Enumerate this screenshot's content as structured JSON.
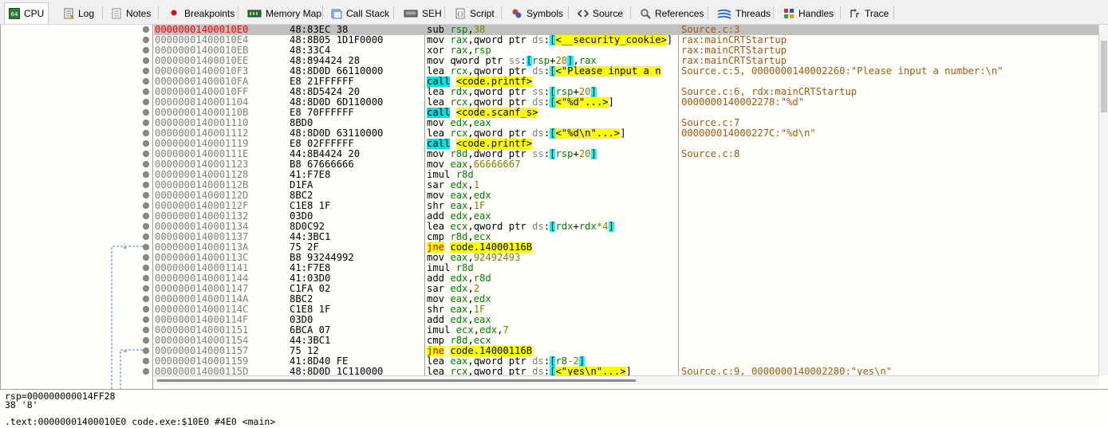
{
  "tabs": [
    {
      "label": "CPU",
      "icon": "cpu-icon",
      "active": true
    },
    {
      "label": "Log",
      "icon": "log-icon"
    },
    {
      "label": "Notes",
      "icon": "notes-icon"
    },
    {
      "label": "Breakpoints",
      "icon": "breakpoint-dot-icon"
    },
    {
      "label": "Memory Map",
      "icon": "memory-map-icon"
    },
    {
      "label": "Call Stack",
      "icon": "call-stack-icon"
    },
    {
      "label": "SEH",
      "icon": "seh-icon"
    },
    {
      "label": "Script",
      "icon": "script-icon"
    },
    {
      "label": "Symbols",
      "icon": "symbols-icon"
    },
    {
      "label": "Source",
      "icon": "source-icon"
    },
    {
      "label": "References",
      "icon": "references-icon"
    },
    {
      "label": "Threads",
      "icon": "threads-icon"
    },
    {
      "label": "Handles",
      "icon": "handles-icon"
    },
    {
      "label": "Trace",
      "icon": "trace-icon"
    }
  ],
  "cpu_icon_text": "64",
  "colors": {
    "selected_address": "#ff0000",
    "comment": "#a05a14",
    "register": "#008000",
    "highlight": "#ffff00",
    "call_highlight": "#00e0e0"
  },
  "disassembly": [
    {
      "address": "00000001400010E0",
      "bytes": "48:83EC 38",
      "instr": "sub rsp,38",
      "comment": "Source.c:3"
    },
    {
      "address": "00000001400010E4",
      "bytes": "48:8B05 1D1F0000",
      "instr": "mov rax,qword ptr ds:[<__security_cookie>]",
      "comment": "rax:mainCRTStartup"
    },
    {
      "address": "00000001400010EB",
      "bytes": "48:33C4",
      "instr": "xor rax,rsp",
      "comment": "rax:mainCRTStartup"
    },
    {
      "address": "00000001400010EE",
      "bytes": "48:894424 28",
      "instr": "mov qword ptr ss:[rsp+28],rax",
      "comment": "rax:mainCRTStartup"
    },
    {
      "address": "00000001400010F3",
      "bytes": "48:8D0D 66110000",
      "instr": "lea rcx,qword ptr ds:[<\"Please input a n",
      "comment": "Source.c:5, 0000000140002260:\"Please input a number:\\n\""
    },
    {
      "address": "00000001400010FA",
      "bytes": "E8 21FFFFFF",
      "instr": "call <code.printf>",
      "comment": ""
    },
    {
      "address": "00000001400010FF",
      "bytes": "48:8D5424 20",
      "instr": "lea rdx,qword ptr ss:[rsp+20]",
      "comment": "Source.c:6, rdx:mainCRTStartup"
    },
    {
      "address": "0000000140001104",
      "bytes": "48:8D0D 6D110000",
      "instr": "lea rcx,qword ptr ds:[<\"%d\"...>]",
      "comment": "0000000140002278:\"%d\""
    },
    {
      "address": "000000014000110B",
      "bytes": "E8 70FFFFFF",
      "instr": "call <code.scanf_s>",
      "comment": ""
    },
    {
      "address": "0000000140001110",
      "bytes": "8BD0",
      "instr": "mov edx,eax",
      "comment": "Source.c:7"
    },
    {
      "address": "0000000140001112",
      "bytes": "48:8D0D 63110000",
      "instr": "lea rcx,qword ptr ds:[<\"%d\\n\"...>]",
      "comment": "000000014000227C:\"%d\\n\""
    },
    {
      "address": "0000000140001119",
      "bytes": "E8 02FFFFFF",
      "instr": "call <code.printf>",
      "comment": ""
    },
    {
      "address": "000000014000111E",
      "bytes": "44:8B4424 20",
      "instr": "mov r8d,dword ptr ss:[rsp+20]",
      "comment": "Source.c:8"
    },
    {
      "address": "0000000140001123",
      "bytes": "B8 67666666",
      "instr": "mov eax,66666667",
      "comment": ""
    },
    {
      "address": "0000000140001128",
      "bytes": "41:F7E8",
      "instr": "imul r8d",
      "comment": ""
    },
    {
      "address": "000000014000112B",
      "bytes": "D1FA",
      "instr": "sar edx,1",
      "comment": ""
    },
    {
      "address": "000000014000112D",
      "bytes": "8BC2",
      "instr": "mov eax,edx",
      "comment": ""
    },
    {
      "address": "000000014000112F",
      "bytes": "C1E8 1F",
      "instr": "shr eax,1F",
      "comment": ""
    },
    {
      "address": "0000000140001132",
      "bytes": "03D0",
      "instr": "add edx,eax",
      "comment": ""
    },
    {
      "address": "0000000140001134",
      "bytes": "8D0C92",
      "instr": "lea ecx,qword ptr ds:[rdx+rdx*4]",
      "comment": ""
    },
    {
      "address": "0000000140001137",
      "bytes": "44:3BC1",
      "instr": "cmp r8d,ecx",
      "comment": ""
    },
    {
      "address": "000000014000113A",
      "bytes": "75 2F",
      "instr": "jne code.14000116B",
      "comment": ""
    },
    {
      "address": "000000014000113C",
      "bytes": "B8 93244992",
      "instr": "mov eax,92492493",
      "comment": ""
    },
    {
      "address": "0000000140001141",
      "bytes": "41:F7E8",
      "instr": "imul r8d",
      "comment": ""
    },
    {
      "address": "0000000140001144",
      "bytes": "41:03D0",
      "instr": "add edx,r8d",
      "comment": ""
    },
    {
      "address": "0000000140001147",
      "bytes": "C1FA 02",
      "instr": "sar edx,2",
      "comment": ""
    },
    {
      "address": "000000014000114A",
      "bytes": "8BC2",
      "instr": "mov eax,edx",
      "comment": ""
    },
    {
      "address": "000000014000114C",
      "bytes": "C1E8 1F",
      "instr": "shr eax,1F",
      "comment": ""
    },
    {
      "address": "000000014000114F",
      "bytes": "03D0",
      "instr": "add edx,eax",
      "comment": ""
    },
    {
      "address": "0000000140001151",
      "bytes": "6BCA 07",
      "instr": "imul ecx,edx,7",
      "comment": ""
    },
    {
      "address": "0000000140001154",
      "bytes": "44:3BC1",
      "instr": "cmp r8d,ecx",
      "comment": ""
    },
    {
      "address": "0000000140001157",
      "bytes": "75 12",
      "instr": "jne code.14000116B",
      "comment": ""
    },
    {
      "address": "0000000140001159",
      "bytes": "41:8D40 FE",
      "instr": "lea eax,qword ptr ds:[r8-2]",
      "comment": ""
    },
    {
      "address": "000000014000115D",
      "bytes": "48:8D0D 1C110000",
      "instr": "lea rcx,qword ptr ds:[<\"yes\\n\"...>]",
      "comment": "Source.c:9, 0000000140002280:\"yes\\n\""
    }
  ],
  "info": {
    "line1": "rsp=000000000014FF28",
    "line2": "38 '8'",
    "line3": ".text:00000001400010E0 code.exe:$10E0 #4E0 <main>"
  }
}
